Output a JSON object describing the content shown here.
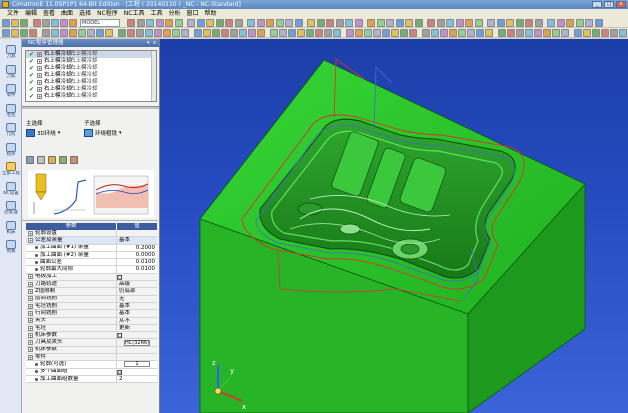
{
  "window": {
    "title": "CimatronE 11.0SP1P1 64-Bit Edition - [工程 ( 20140110 ) _NC - NC-Standard]"
  },
  "menubar": {
    "items": [
      "文件",
      "编辑",
      "查看",
      "曲面",
      "选择",
      "NC程序",
      "NC工具",
      "工具",
      "分析",
      "窗口",
      "帮助"
    ]
  },
  "toolbar": {
    "model_combo": "MODEL"
  },
  "left_strip": {
    "items": [
      {
        "label": "刀具",
        "icon": "tool-icon"
      },
      {
        "label": "刀轨",
        "icon": "toolpath-icon"
      },
      {
        "label": "零件",
        "icon": "part-icon"
      },
      {
        "label": "毛坯",
        "icon": "stock-icon"
      },
      {
        "label": "几何",
        "icon": "geometry-icon"
      },
      {
        "label": "程序",
        "icon": "program-icon"
      },
      {
        "label": "全部工程",
        "icon": "all-proc-icon"
      },
      {
        "label": "NC设置",
        "icon": "nc-setup-icon"
      },
      {
        "label": "后处理",
        "icon": "post-icon"
      },
      {
        "label": "机床",
        "icon": "machine-icon"
      },
      {
        "label": "仿真",
        "icon": "simulate-icon"
      }
    ]
  },
  "panel": {
    "title": "NC程序管理器"
  },
  "process_tree": {
    "rows": [
      {
        "name": "右上模冷却",
        "status": "右上模冷却"
      },
      {
        "name": "右上模冷却",
        "status": "右上模冷却"
      },
      {
        "name": "右上模冷却",
        "status": "右上模冷却"
      },
      {
        "name": "右上模冷却",
        "status": "右上模冷却"
      },
      {
        "name": "右上模冷却",
        "status": "右上模冷却"
      },
      {
        "name": "右上模冷却",
        "status": "右上模冷却"
      },
      {
        "name": "右上模冷却",
        "status": "右上模冷却"
      }
    ]
  },
  "process_type": {
    "main_label": "主选择",
    "sub_label": "子选择",
    "main_value": "3D环绕",
    "sub_value": "环绕粗铣"
  },
  "param_grid": {
    "header": {
      "name": "参数",
      "value": "值"
    },
    "rows": [
      {
        "kind": "group",
        "name": "轮廓设置",
        "value": ""
      },
      {
        "kind": "group",
        "name": "公差及余量",
        "value": "基本",
        "highlight": true
      },
      {
        "kind": "item",
        "name": "加工曲面 (#1) 余量",
        "value": "0.2000",
        "num": true
      },
      {
        "kind": "item",
        "name": "加工曲面 (#2) 余量",
        "value": "0.0000",
        "num": true
      },
      {
        "kind": "item",
        "name": "曲面公差",
        "value": "0.0100",
        "num": true
      },
      {
        "kind": "item",
        "name": "轮廓最大间隙",
        "value": "0.0100",
        "num": true
      },
      {
        "kind": "group",
        "name": "电极加工",
        "value": "☐",
        "checkbox": true
      },
      {
        "kind": "group",
        "name": "刀路轨迹",
        "value": "高级"
      },
      {
        "kind": "group",
        "name": "Z值限制",
        "value": "仍底部"
      },
      {
        "kind": "group",
        "name": "层间铣削",
        "value": "无"
      },
      {
        "kind": "group",
        "name": "毛坯铣削",
        "value": "基本"
      },
      {
        "kind": "group",
        "name": "行间铣削",
        "value": "基本"
      },
      {
        "kind": "group",
        "name": "夹头",
        "value": "从不"
      },
      {
        "kind": "group",
        "name": "毛坯",
        "value": "更新"
      },
      {
        "kind": "group",
        "name": "机床参数",
        "value": "☐",
        "checkbox": true
      },
      {
        "kind": "group",
        "name": "刀具及夹头",
        "value": "HC(32R6)",
        "box": true
      },
      {
        "kind": "group",
        "name": "机床参数",
        "value": ""
      },
      {
        "kind": "group",
        "name": "零件",
        "value": ""
      },
      {
        "kind": "item",
        "name": "轮廓(可选)",
        "value": "1",
        "box": true
      },
      {
        "kind": "item",
        "name": "多个曲面组",
        "value": "☑",
        "checkbox": true
      },
      {
        "kind": "item",
        "name": "加工曲面组数量",
        "value": "2"
      }
    ]
  },
  "colors": {
    "part": "#2fc82f",
    "background_top": "#1c3ea8",
    "background_bottom": "#3a64d8",
    "toolpath_red": "#e03030",
    "toolpath_blue": "#4a66d0"
  }
}
